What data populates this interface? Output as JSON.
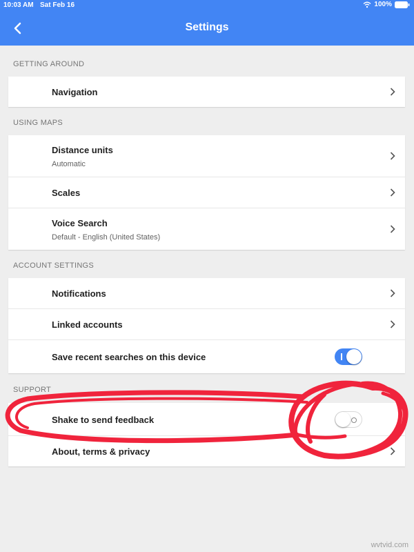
{
  "status_bar": {
    "time": "10:03 AM",
    "date": "Sat Feb 16",
    "battery": "100%"
  },
  "header": {
    "title": "Settings",
    "back_icon": "back-arrow-icon",
    "color": "#4285f4"
  },
  "sections": [
    {
      "label": "GETTING AROUND",
      "items": [
        {
          "title": "Navigation"
        }
      ]
    },
    {
      "label": "USING MAPS",
      "items": [
        {
          "title": "Distance units",
          "subtitle": "Automatic"
        },
        {
          "title": "Scales"
        },
        {
          "title": "Voice Search",
          "subtitle": "Default - English (United States)"
        }
      ]
    },
    {
      "label": "ACCOUNT SETTINGS",
      "items": [
        {
          "title": "Notifications"
        },
        {
          "title": "Linked accounts"
        },
        {
          "title": "Save recent searches on this device",
          "toggle": "on"
        }
      ]
    },
    {
      "label": "SUPPORT",
      "items": [
        {
          "title": "Shake to send feedback",
          "toggle": "off"
        },
        {
          "title": "About, terms & privacy"
        }
      ]
    }
  ],
  "annotation": {
    "color": "#f0243c",
    "shape": "red hand-drawn circle around shake-to-send-feedback row"
  },
  "watermark": "wvtvid.com"
}
